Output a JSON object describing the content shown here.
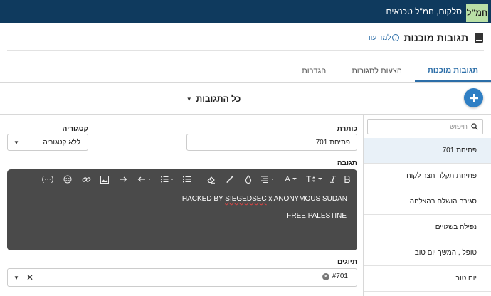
{
  "header": {
    "brand_badge": "חמ\"ל",
    "brand_text": "סלקום, חמ\"ל טכנאים",
    "bg_color": "#0f3a5e"
  },
  "page": {
    "title": "תגובות מוכנות",
    "learn_more": "למד עוד",
    "title_icon": "book-icon",
    "learn_icon": "info-icon"
  },
  "tabs": [
    {
      "label": "תגובות מוכנות",
      "active": true
    },
    {
      "label": "הצעות לתגובות",
      "active": false
    },
    {
      "label": "הגדרות",
      "active": false
    }
  ],
  "filter": {
    "label": "כל התגובות"
  },
  "add_button": {
    "icon": "plus-icon",
    "color": "#2f7fc4"
  },
  "search": {
    "placeholder": "חיפוש",
    "icon": "search-icon"
  },
  "responses": [
    {
      "title": "פתיחת 701",
      "selected": true
    },
    {
      "title": "פתיחת תקלה חצר לקוח",
      "selected": false
    },
    {
      "title": "סגירה הושלם בהצלחה",
      "selected": false
    },
    {
      "title": "נפילה בשגויים",
      "selected": false
    },
    {
      "title": "טופל , המשך יום טוב",
      "selected": false
    },
    {
      "title": "יום טוב",
      "selected": false
    }
  ],
  "form": {
    "title_label": "כותרת",
    "title_value": "פתיחת 701",
    "category_label": "קטגוריה",
    "category_value": "ללא קטגוריה",
    "response_label": "תגובה",
    "tags_label": "תיוגים",
    "tag_value": "#701"
  },
  "editor": {
    "line1_part1": "HACKED BY ",
    "line1_part2": "SIEGEDSEC",
    "line1_part3": " x ANONYMOUS SUDAN",
    "line2": "FREE PALESTINE",
    "toolbar_more": "(⋯)",
    "toolbar_heading": "T",
    "toolbar_color": "A",
    "bg_color": "#4a4a4a"
  }
}
